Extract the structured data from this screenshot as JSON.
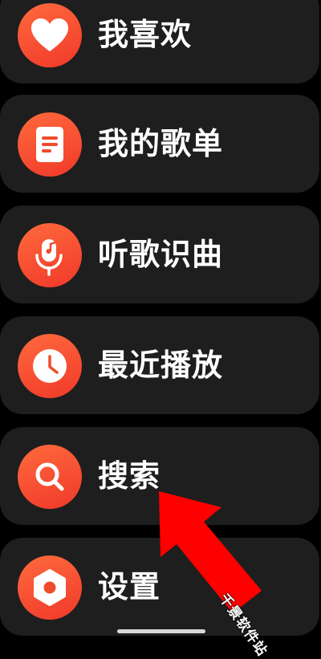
{
  "menu": {
    "items": [
      {
        "label": "我喜欢",
        "icon": "heart-icon"
      },
      {
        "label": "我的歌单",
        "icon": "playlist-icon"
      },
      {
        "label": "听歌识曲",
        "icon": "mic-note-icon"
      },
      {
        "label": "最近播放",
        "icon": "clock-icon"
      },
      {
        "label": "搜索",
        "icon": "search-icon"
      },
      {
        "label": "设置",
        "icon": "settings-icon"
      }
    ]
  },
  "watermark": {
    "text": "千景软件站"
  },
  "colors": {
    "background": "#000000",
    "card": "#1e1e1e",
    "accent": "#f04a2d",
    "annotation_arrow": "#ff0000",
    "text": "#ffffff"
  }
}
